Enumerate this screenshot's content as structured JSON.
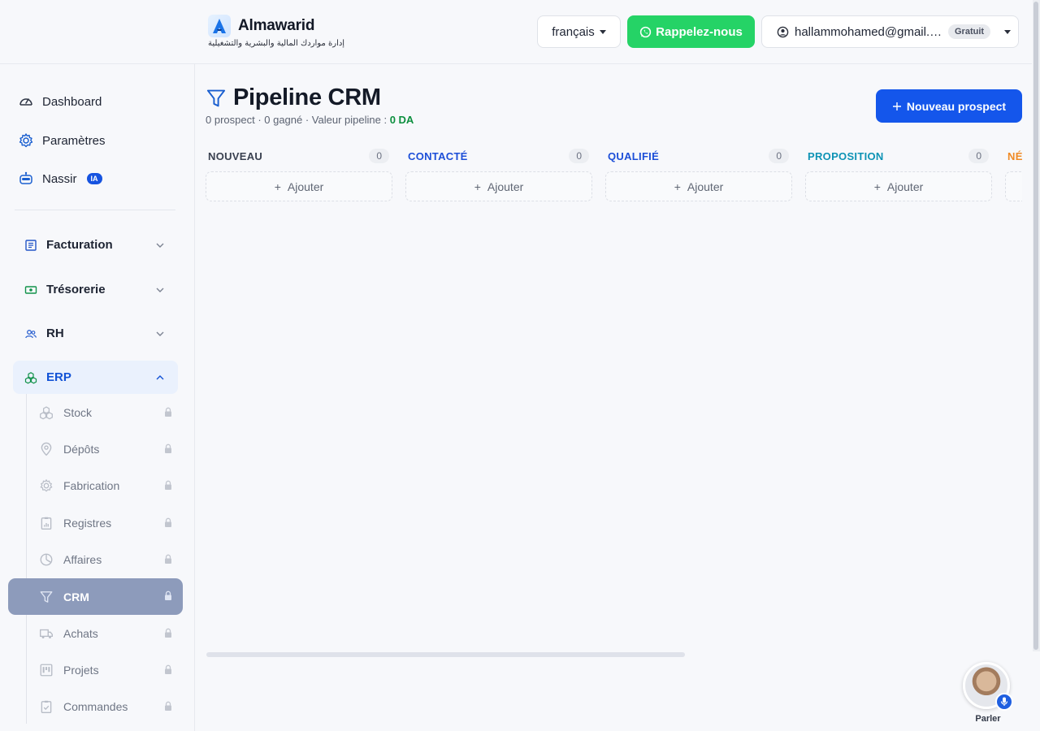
{
  "brand": {
    "name": "Almawarid",
    "tagline": "إدارة مواردك المالية والبشرية والتشغيلية"
  },
  "header": {
    "language": "français",
    "callback_label": "Rappelez-nous",
    "user_email": "hallammohamed@gmail.com",
    "plan_badge": "Gratuit"
  },
  "sidebar": {
    "top": [
      {
        "label": "Dashboard",
        "icon": "gauge-icon"
      },
      {
        "label": "Paramètres",
        "icon": "gear-icon"
      },
      {
        "label": "Nassir",
        "icon": "robot-icon",
        "badge": "IA"
      }
    ],
    "groups": [
      {
        "label": "Facturation",
        "icon": "invoice-icon"
      },
      {
        "label": "Trésorerie",
        "icon": "cash-icon"
      },
      {
        "label": "RH",
        "icon": "users-icon"
      },
      {
        "label": "ERP",
        "icon": "cubes-icon",
        "expanded": true
      }
    ],
    "erp_items": [
      {
        "label": "Stock",
        "icon": "cubes-icon",
        "locked": true
      },
      {
        "label": "Dépôts",
        "icon": "map-pin-icon",
        "locked": true
      },
      {
        "label": "Fabrication",
        "icon": "gear-icon",
        "locked": true
      },
      {
        "label": "Registres",
        "icon": "clipboard-chart-icon",
        "locked": true
      },
      {
        "label": "Affaires",
        "icon": "pie-chart-icon",
        "locked": true
      },
      {
        "label": "CRM",
        "icon": "funnel-icon",
        "locked": true,
        "active": true
      },
      {
        "label": "Achats",
        "icon": "truck-icon",
        "locked": true
      },
      {
        "label": "Projets",
        "icon": "kanban-icon",
        "locked": true
      },
      {
        "label": "Commandes",
        "icon": "clipboard-check-icon",
        "locked": true
      }
    ]
  },
  "page": {
    "title": "Pipeline CRM",
    "subtitle_prefix": "0 prospect · 0 gagné · Valeur pipeline : ",
    "pipeline_value": "0 DA",
    "new_button": "Nouveau prospect"
  },
  "columns": [
    {
      "title": "NOUVEAU",
      "count": "0",
      "color": "#3a4150"
    },
    {
      "title": "CONTACTÉ",
      "count": "0",
      "color": "#1d4fd8"
    },
    {
      "title": "QUALIFIÉ",
      "count": "0",
      "color": "#1d4fd8"
    },
    {
      "title": "PROPOSITION",
      "count": "0",
      "color": "#0e93b5"
    },
    {
      "title": "NÉ",
      "count": "",
      "color": "#f08a24"
    }
  ],
  "add_label": "Ajouter",
  "assistant": {
    "label": "Parler"
  },
  "colors": {
    "primary": "#1456eb",
    "whatsapp": "#25d366",
    "success": "#0c8f3e",
    "active_nav": "#8d9bbb"
  }
}
